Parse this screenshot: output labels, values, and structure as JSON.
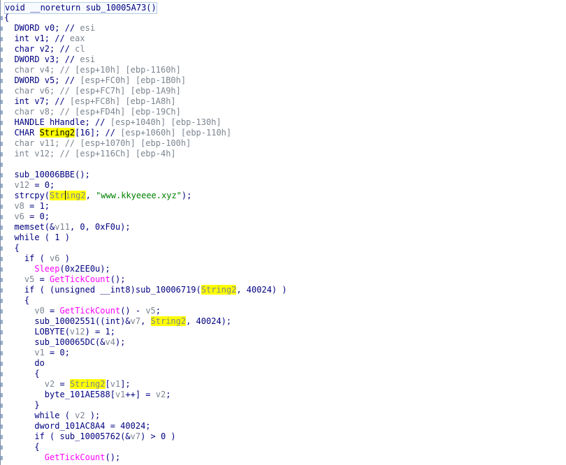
{
  "code_lines": [
    [
      {
        "t": "void __noreturn sub_10005A73()",
        "c": "k"
      }
    ],
    [
      {
        "t": "{",
        "c": "k"
      }
    ],
    [
      {
        "t": "  DWORD v0; // ",
        "c": "k"
      },
      {
        "t": "esi",
        "c": "g"
      }
    ],
    [
      {
        "t": "  int v1; // ",
        "c": "k"
      },
      {
        "t": "eax",
        "c": "g"
      }
    ],
    [
      {
        "t": "  char v2; // ",
        "c": "k"
      },
      {
        "t": "cl",
        "c": "g"
      }
    ],
    [
      {
        "t": "  DWORD v3; // ",
        "c": "k"
      },
      {
        "t": "esi",
        "c": "g"
      }
    ],
    [
      {
        "t": "  char v4; // [esp+10h] [ebp-1160h]",
        "c": "g"
      }
    ],
    [
      {
        "t": "  DWORD v5; // ",
        "c": "k"
      },
      {
        "t": "[esp+FC0h] [ebp-1B0h]",
        "c": "g"
      }
    ],
    [
      {
        "t": "  char v6; // [esp+FC7h] [ebp-1A9h]",
        "c": "g"
      }
    ],
    [
      {
        "t": "  int v7; // ",
        "c": "k"
      },
      {
        "t": "[esp+FC8h] [ebp-1A8h]",
        "c": "g"
      }
    ],
    [
      {
        "t": "  char v8; // [esp+FD4h] [ebp-19Ch]",
        "c": "g"
      }
    ],
    [
      {
        "t": "  HANDLE hHandle; // ",
        "c": "k"
      },
      {
        "t": "[esp+1040h] [ebp-130h]",
        "c": "g"
      }
    ],
    [
      {
        "t": "  CHAR ",
        "c": "k"
      },
      {
        "t": "String2",
        "c": "hl"
      },
      {
        "t": "[16]; // ",
        "c": "k"
      },
      {
        "t": "[esp+1060h] [ebp-110h]",
        "c": "g"
      }
    ],
    [
      {
        "t": "  char v11; // [esp+1070h] [ebp-100h]",
        "c": "g"
      }
    ],
    [
      {
        "t": "  int v12; // [esp+116Ch] [ebp-4h]",
        "c": "g"
      }
    ],
    [
      {
        "t": "",
        "c": "k"
      }
    ],
    [
      {
        "t": "  sub_10006BBE();",
        "c": "k"
      }
    ],
    [
      {
        "t": "  v12",
        "c": "g"
      },
      {
        "t": " = 0;",
        "c": "k"
      }
    ],
    [
      {
        "t": "  strcpy(",
        "c": "k"
      },
      {
        "t": "Str",
        "c": "hlg"
      },
      {
        "t": "CARET",
        "c": "caret"
      },
      {
        "t": "ing2",
        "c": "hlg"
      },
      {
        "t": ", ",
        "c": "k"
      },
      {
        "t": "\"www.kkyeeee.xyz\"",
        "c": "s"
      },
      {
        "t": ");",
        "c": "k"
      }
    ],
    [
      {
        "t": "  v8",
        "c": "g"
      },
      {
        "t": " = 1;",
        "c": "k"
      }
    ],
    [
      {
        "t": "  v6",
        "c": "g"
      },
      {
        "t": " = 0;",
        "c": "k"
      }
    ],
    [
      {
        "t": "  memset(&",
        "c": "k"
      },
      {
        "t": "v11",
        "c": "g"
      },
      {
        "t": ", 0, 0xF0u);",
        "c": "k"
      }
    ],
    [
      {
        "t": "  while ( 1 )",
        "c": "k"
      }
    ],
    [
      {
        "t": "  {",
        "c": "k"
      }
    ],
    [
      {
        "t": "    if ( ",
        "c": "k"
      },
      {
        "t": "v6",
        "c": "g"
      },
      {
        "t": " )",
        "c": "k"
      }
    ],
    [
      {
        "t": "      ",
        "c": "k"
      },
      {
        "t": "Sleep",
        "c": "p"
      },
      {
        "t": "(0x2EE0u);",
        "c": "k"
      }
    ],
    [
      {
        "t": "    v5",
        "c": "g"
      },
      {
        "t": " = ",
        "c": "k"
      },
      {
        "t": "GetTickCount",
        "c": "p"
      },
      {
        "t": "();",
        "c": "k"
      }
    ],
    [
      {
        "t": "    if ( (unsigned __int8)sub_10006719(",
        "c": "k"
      },
      {
        "t": "String2",
        "c": "hlg"
      },
      {
        "t": ", 40024) )",
        "c": "k"
      }
    ],
    [
      {
        "t": "    {",
        "c": "k"
      }
    ],
    [
      {
        "t": "      v0",
        "c": "g"
      },
      {
        "t": " = ",
        "c": "k"
      },
      {
        "t": "GetTickCount",
        "c": "p"
      },
      {
        "t": "() - ",
        "c": "k"
      },
      {
        "t": "v5",
        "c": "g"
      },
      {
        "t": ";",
        "c": "k"
      }
    ],
    [
      {
        "t": "      sub_10002551((int)&",
        "c": "k"
      },
      {
        "t": "v7",
        "c": "g"
      },
      {
        "t": ", ",
        "c": "k"
      },
      {
        "t": "String2",
        "c": "hlg"
      },
      {
        "t": ", 40024);",
        "c": "k"
      }
    ],
    [
      {
        "t": "      LOBYTE(",
        "c": "k"
      },
      {
        "t": "v12",
        "c": "g"
      },
      {
        "t": ") = 1;",
        "c": "k"
      }
    ],
    [
      {
        "t": "      sub_100065DC(&",
        "c": "k"
      },
      {
        "t": "v4",
        "c": "g"
      },
      {
        "t": ");",
        "c": "k"
      }
    ],
    [
      {
        "t": "      v1",
        "c": "g"
      },
      {
        "t": " = 0;",
        "c": "k"
      }
    ],
    [
      {
        "t": "      do",
        "c": "k"
      }
    ],
    [
      {
        "t": "      {",
        "c": "k"
      }
    ],
    [
      {
        "t": "        v2",
        "c": "g"
      },
      {
        "t": " = ",
        "c": "k"
      },
      {
        "t": "String2",
        "c": "hlg"
      },
      {
        "t": "[",
        "c": "k"
      },
      {
        "t": "v1",
        "c": "g"
      },
      {
        "t": "];",
        "c": "k"
      }
    ],
    [
      {
        "t": "        byte_101AE588[",
        "c": "k"
      },
      {
        "t": "v1",
        "c": "g"
      },
      {
        "t": "++] = ",
        "c": "k"
      },
      {
        "t": "v2",
        "c": "g"
      },
      {
        "t": ";",
        "c": "k"
      }
    ],
    [
      {
        "t": "      }",
        "c": "k"
      }
    ],
    [
      {
        "t": "      while ( ",
        "c": "k"
      },
      {
        "t": "v2",
        "c": "g"
      },
      {
        "t": " );",
        "c": "k"
      }
    ],
    [
      {
        "t": "      dword_101AC8A4 = 40024;",
        "c": "k"
      }
    ],
    [
      {
        "t": "      if ( sub_10005762(&",
        "c": "k"
      },
      {
        "t": "v7",
        "c": "g"
      },
      {
        "t": ") > 0 )",
        "c": "k"
      }
    ],
    [
      {
        "t": "      {",
        "c": "k"
      }
    ],
    [
      {
        "t": "        ",
        "c": "k"
      },
      {
        "t": "GetTickCount",
        "c": "p"
      },
      {
        "t": "();",
        "c": "k"
      }
    ]
  ],
  "colors": {
    "keyword": "#000080",
    "comment": "#7c8590",
    "string": "#008000",
    "api": "#ff00ff",
    "highlight": "#ffff00",
    "background": "#ffffff"
  }
}
